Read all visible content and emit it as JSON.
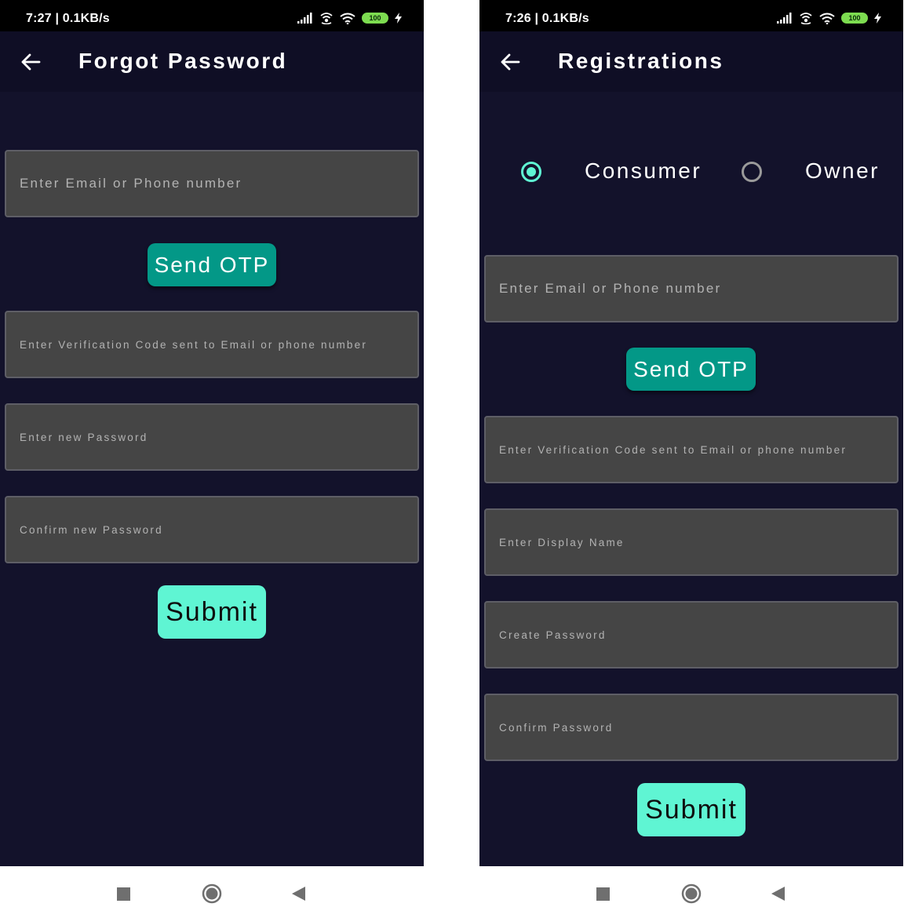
{
  "screens": [
    {
      "status": {
        "time": "7:27 | 0.1KB/s",
        "battery": "100"
      },
      "title": "Forgot Password",
      "fields": [
        {
          "placeholder": "Enter Email or Phone number"
        },
        {
          "placeholder": "Enter Verification Code sent to Email or phone number"
        },
        {
          "placeholder": "Enter new Password"
        },
        {
          "placeholder": "Confirm new Password"
        }
      ],
      "send_otp_label": "Send OTP",
      "submit_label": "Submit"
    },
    {
      "status": {
        "time": "7:26 | 0.1KB/s",
        "battery": "100"
      },
      "title": "Registrations",
      "user_type": {
        "options": [
          "Consumer",
          "Owner"
        ],
        "selected": "Consumer"
      },
      "fields": [
        {
          "placeholder": "Enter Email or Phone number"
        },
        {
          "placeholder": "Enter Verification Code sent to Email or phone number"
        },
        {
          "placeholder": "Enter Display Name"
        },
        {
          "placeholder": "Create Password"
        },
        {
          "placeholder": "Confirm Password"
        }
      ],
      "send_otp_label": "Send OTP",
      "submit_label": "Submit"
    }
  ],
  "icons": {
    "back": "arrow-left-icon",
    "signal": "signal-icon",
    "hotspot": "hotspot-icon",
    "wifi": "wifi-icon",
    "battery": "battery-icon",
    "charging": "charging-icon",
    "nav_recents": "square-icon",
    "nav_home": "circle-icon",
    "nav_back": "triangle-back-icon"
  },
  "colors": {
    "background": "#13122b",
    "appbar": "#0f0e25",
    "field": "#454545",
    "send_otp": "#039887",
    "submit": "#5ff5d3",
    "radio_accent": "#5ff5d3"
  }
}
